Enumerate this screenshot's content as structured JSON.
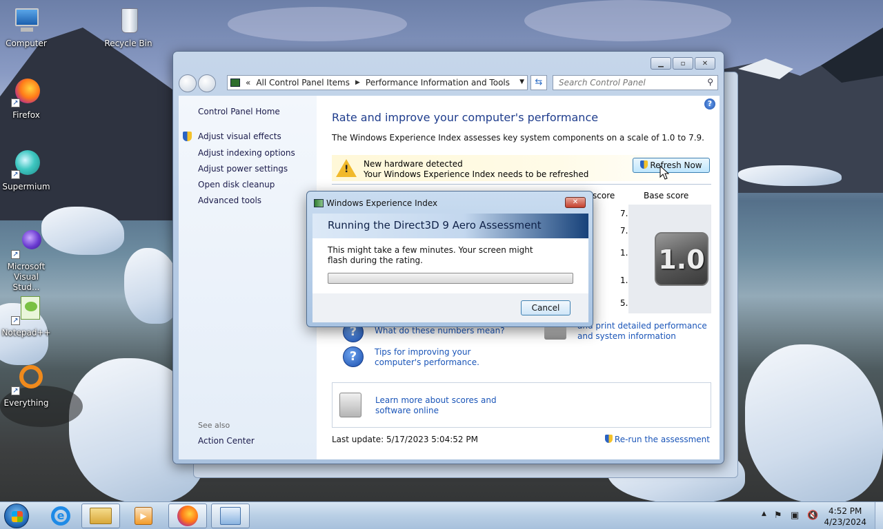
{
  "desktop": {
    "icons": [
      {
        "label": "Computer"
      },
      {
        "label": "Recycle Bin"
      },
      {
        "label": "Firefox"
      },
      {
        "label": "Supermium"
      },
      {
        "label": "Microsoft Visual Stud..."
      },
      {
        "label": "Notepad++"
      },
      {
        "label": "Everything"
      }
    ]
  },
  "window": {
    "address": {
      "chevron": "«",
      "crumbs": [
        "All Control Panel Items",
        "Performance Information and Tools"
      ]
    },
    "search_placeholder": "Search Control Panel",
    "sidebar": {
      "home": "Control Panel Home",
      "links": [
        "Adjust visual effects",
        "Adjust indexing options",
        "Adjust power settings",
        "Open disk cleanup",
        "Advanced tools"
      ],
      "see_also": "See also",
      "action_center": "Action Center"
    },
    "content": {
      "title": "Rate and improve your computer's performance",
      "description": "The Windows Experience Index assesses key system components on a scale of 1.0 to 7.9.",
      "warning_line1": "New hardware detected",
      "warning_line2": "Your Windows Experience Index needs to be refreshed",
      "refresh_button": "Refresh Now",
      "subscore_header": "score",
      "basescore_header": "Base score",
      "subscores": [
        "7.5",
        "7.6",
        "1.0",
        "1.0",
        "5.9"
      ],
      "base_score": "1.0",
      "link_numbers": "What do these numbers mean?",
      "link_print": "and print detailed performance and system information",
      "link_tips": "Tips for improving your computer's performance.",
      "link_learn": "Learn more about scores and software online",
      "last_update": "Last update: 5/17/2023 5:04:52 PM",
      "rerun": "Re-run the assessment"
    }
  },
  "dialog": {
    "title": "Windows Experience Index",
    "heading": "Running the Direct3D 9 Aero Assessment",
    "message": "This might take a few minutes. Your screen might flash during the rating.",
    "progress": 0,
    "cancel": "Cancel"
  },
  "taskbar": {
    "time": "4:52 PM",
    "date": "4/23/2024"
  }
}
